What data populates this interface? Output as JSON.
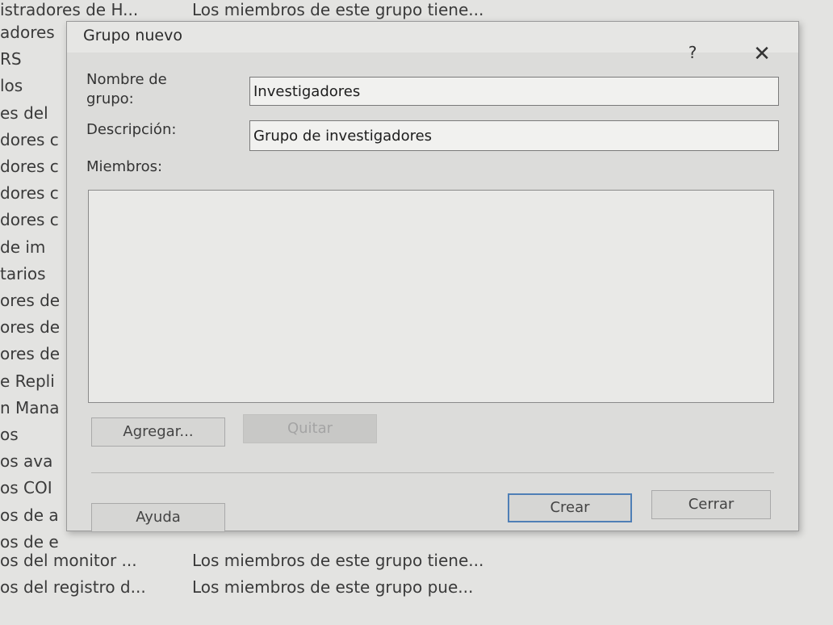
{
  "background_list": {
    "top_row": {
      "name": "istradores de H...",
      "description": "Los miembros de este grupo tiene..."
    },
    "rows": [
      "adores",
      "RS",
      "los",
      "es del",
      "dores c",
      "dores c",
      "dores c",
      "dores c",
      " de im",
      "tarios",
      "ores de",
      "ores de",
      "ores de",
      "e Repli",
      "n Mana",
      "os",
      "os ava",
      "os COI",
      "os de a",
      "os de e"
    ],
    "bottom_rows": [
      {
        "name": "os del monitor ...",
        "description": "Los miembros de este grupo tiene..."
      },
      {
        "name": "os del registro d...",
        "description": "Los miembros de este grupo pue..."
      }
    ]
  },
  "dialog": {
    "title": "Grupo nuevo",
    "help_label": "?",
    "close_label": "✕",
    "group_name_label_line1": "Nombre de",
    "group_name_label_line2": "grupo:",
    "group_name_value": "Investigadores",
    "description_label": "Descripción:",
    "description_value": "Grupo de investigadores",
    "members_label": "Miembros:",
    "members": [],
    "add_button": "Agregar...",
    "remove_button": "Quitar",
    "help_button": "Ayuda",
    "create_button": "Crear",
    "close_button": "Cerrar"
  }
}
